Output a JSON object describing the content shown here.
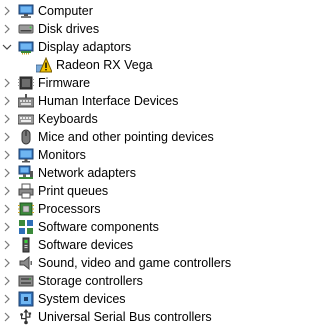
{
  "tree": {
    "items": [
      {
        "label": "Computer",
        "icon": "computer-icon",
        "expanded": false,
        "level": 0
      },
      {
        "label": "Disk drives",
        "icon": "disk-drive-icon",
        "expanded": false,
        "level": 0
      },
      {
        "label": "Display adaptors",
        "icon": "display-adapter-icon",
        "expanded": true,
        "level": 0
      },
      {
        "label": "Radeon RX Vega",
        "icon": "warning-icon",
        "expanded": false,
        "level": 1
      },
      {
        "label": "Firmware",
        "icon": "firmware-icon",
        "expanded": false,
        "level": 0
      },
      {
        "label": "Human Interface Devices",
        "icon": "hid-icon",
        "expanded": false,
        "level": 0
      },
      {
        "label": "Keyboards",
        "icon": "keyboard-icon",
        "expanded": false,
        "level": 0
      },
      {
        "label": "Mice and other pointing devices",
        "icon": "mouse-icon",
        "expanded": false,
        "level": 0
      },
      {
        "label": "Monitors",
        "icon": "monitor-icon",
        "expanded": false,
        "level": 0
      },
      {
        "label": "Network adapters",
        "icon": "network-adapter-icon",
        "expanded": false,
        "level": 0
      },
      {
        "label": "Print queues",
        "icon": "printer-icon",
        "expanded": false,
        "level": 0
      },
      {
        "label": "Processors",
        "icon": "processor-icon",
        "expanded": false,
        "level": 0
      },
      {
        "label": "Software components",
        "icon": "software-component-icon",
        "expanded": false,
        "level": 0
      },
      {
        "label": "Software devices",
        "icon": "software-device-icon",
        "expanded": false,
        "level": 0
      },
      {
        "label": "Sound, video and game controllers",
        "icon": "speaker-icon",
        "expanded": false,
        "level": 0
      },
      {
        "label": "Storage controllers",
        "icon": "storage-controller-icon",
        "expanded": false,
        "level": 0
      },
      {
        "label": "System devices",
        "icon": "system-device-icon",
        "expanded": false,
        "level": 0
      },
      {
        "label": "Universal Serial Bus controllers",
        "icon": "usb-icon",
        "expanded": false,
        "level": 0
      }
    ]
  },
  "colors": {
    "expander": "#7a7a7a",
    "warning": "#f2c200"
  }
}
